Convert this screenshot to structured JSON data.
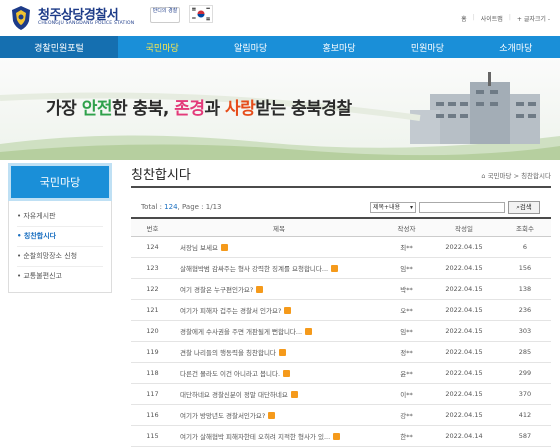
{
  "header": {
    "site_title": "청주상당경찰서",
    "site_subtitle": "CHEONGJU SANGDANG POLICE STATION",
    "badge_text": "반디의 경찰",
    "utils": [
      "홈",
      "사이트맵",
      "글자크기"
    ]
  },
  "nav": {
    "portal": "경찰민원포털",
    "items": [
      "국민마당",
      "알림마당",
      "홍보마당",
      "민원마당",
      "소개마당"
    ],
    "active_index": 0
  },
  "banner": {
    "slogan_prefix": "가장 ",
    "slogan_a": "안전",
    "slogan_mid1": "한 충북, ",
    "slogan_b": "존경",
    "slogan_mid2": "과 ",
    "slogan_c": "사랑",
    "slogan_suffix": "받는 충북경찰"
  },
  "sidebar": {
    "title": "국민마당",
    "items": [
      "자유게시판",
      "칭찬합시다",
      "순찰희망장소 신청",
      "교통불편신고"
    ],
    "active_index": 1
  },
  "board": {
    "title": "칭찬합시다",
    "breadcrumb": "국민마당 > 칭찬합시다",
    "total_label": "Total : ",
    "total": "124",
    "page_label": "Page : ",
    "page": "1/13",
    "search_select": "제목+내용",
    "search_button": "검색",
    "columns": [
      "번호",
      "제목",
      "작성자",
      "작성일",
      "조회수"
    ],
    "rows": [
      {
        "no": "124",
        "title": "서장님 보세요",
        "author": "최**",
        "date": "2022.04.15",
        "views": "6"
      },
      {
        "no": "123",
        "title": "살해협박범 감싸주는 형사 강력한 징계를 요청합니다...",
        "author": "임**",
        "date": "2022.04.15",
        "views": "156"
      },
      {
        "no": "122",
        "title": "여기 경찰은 누구편인가요?",
        "author": "박**",
        "date": "2022.04.15",
        "views": "138"
      },
      {
        "no": "121",
        "title": "여기가 피해자 겁주는 경찰서 인가요?",
        "author": "오**",
        "date": "2022.04.15",
        "views": "236"
      },
      {
        "no": "120",
        "title": "경찰에게 수사권을 주면 개판될게 뻔합니다...",
        "author": "임**",
        "date": "2022.04.15",
        "views": "303"
      },
      {
        "no": "119",
        "title": "견찰 나리들의 행동력을 칭찬합니다",
        "author": "정**",
        "date": "2022.04.15",
        "views": "285"
      },
      {
        "no": "118",
        "title": "다른건 몰라도 이건 아니라고 봅니다.",
        "author": "윤**",
        "date": "2022.04.15",
        "views": "299"
      },
      {
        "no": "117",
        "title": "대단하네요 경찰신분이 정말 대단하네요",
        "author": "이**",
        "date": "2022.04.15",
        "views": "370"
      },
      {
        "no": "116",
        "title": "여기가 방망년도 경찰서인가요?",
        "author": "강**",
        "date": "2022.04.15",
        "views": "412"
      },
      {
        "no": "115",
        "title": "여기가 살해협박 피해자한테 오히려 지적한 형사가 있...",
        "author": "한**",
        "date": "2022.04.14",
        "views": "587"
      }
    ]
  },
  "colors": {
    "nav_blue": "#1a8fd8",
    "brand_navy": "#1d3b88",
    "new_tag": "#f59a1b"
  }
}
